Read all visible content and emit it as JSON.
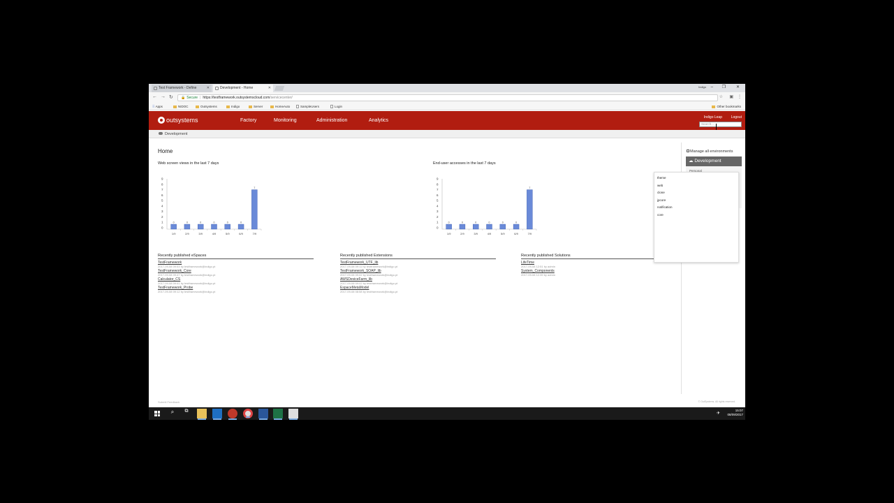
{
  "browser": {
    "tabs": [
      {
        "label": "Test Framework - Define"
      },
      {
        "label": "Development - Home"
      }
    ],
    "window_label": "Indigo",
    "address": {
      "secure_label": "Secure",
      "url_host": "https://testframework.outsystemscloud.com",
      "url_path": "/servicecenter/"
    },
    "bookmarks": [
      "Apps",
      "NIDOC",
      "Outsystems",
      "Indigo",
      "Server",
      "HomeAuto",
      "SampleUsers",
      "Login"
    ],
    "other_bookmarks": "Other bookmarks"
  },
  "header": {
    "logo_text": "outsystems",
    "nav": [
      "Factory",
      "Monitoring",
      "Administration",
      "Analytics"
    ],
    "user": "Indigo Leap",
    "logout": "Logout",
    "search_placeholder": "Search..."
  },
  "subheader": {
    "environment": "Development"
  },
  "page_title": "Home",
  "charts": {
    "screen_views_title": "Web screen views in the last 7 days",
    "accesses_title": "End-user accesses in the last 7 days"
  },
  "chart_data": [
    {
      "type": "bar",
      "title": "Web screen views in the last 7 days",
      "categories": [
        "1/9",
        "2/9",
        "3/9",
        "4/9",
        "5/9",
        "6/9",
        "7/9"
      ],
      "values": [
        0,
        0,
        0,
        0,
        0,
        0,
        7
      ],
      "yticks": [
        0,
        1,
        2,
        3,
        4,
        5,
        6,
        7,
        8,
        9
      ],
      "ylim": [
        0,
        9
      ],
      "color": "#6a8ad8"
    },
    {
      "type": "bar",
      "title": "End-user accesses in the last 7 days",
      "categories": [
        "1/9",
        "2/9",
        "3/9",
        "4/9",
        "5/9",
        "6/9",
        "7/9"
      ],
      "values": [
        0,
        0,
        0,
        0,
        0,
        0,
        7
      ],
      "yticks": [
        0,
        1,
        2,
        3,
        4,
        5,
        6,
        7,
        8,
        9
      ],
      "ylim": [
        0,
        9
      ],
      "color": "#6a8ad8"
    }
  ],
  "sections": {
    "espaces": {
      "title": "Recently published eSpaces",
      "items": [
        {
          "name": "TestFramework",
          "meta": "2017-09-08 09:53 by testframework@indigo.pt"
        },
        {
          "name": "TestFramework_Core",
          "meta": "2017-09-08 09:47 by testframework@indigo.pt"
        },
        {
          "name": "Calculator_CS",
          "meta": "2017-09-08 09:41 by testframework@indigo.pt"
        },
        {
          "name": "TestFramework_Probe",
          "meta": "2017-09-08 09:12 by testframework@indigo.pt"
        }
      ]
    },
    "extensions": {
      "title": "Recently published Extensions",
      "items": [
        {
          "name": "TestFramework_UTF_lib",
          "meta": "2017-09-08 09:11 by testframework@indigo.pt"
        },
        {
          "name": "TestFramework_SOAP_lib",
          "meta": "2017-09-08 09:02 by testframework@indigo.pt"
        },
        {
          "name": "AWSDeviceFarm_lib",
          "meta": "2017-09-08 09:02 by testframework@indigo.pt"
        },
        {
          "name": "EspaceMetaModel",
          "meta": "2017-09-08 08:58 by testframework@indigo.pt"
        }
      ]
    },
    "solutions": {
      "title": "Recently published Solutions",
      "items": [
        {
          "name": "LifeTime",
          "meta": "2017-09-08 12:51 by admin"
        },
        {
          "name": "System_Components",
          "meta": "2017-09-08 12:39 by admin"
        }
      ]
    }
  },
  "right_panel": {
    "manage_link": "Manage all environments",
    "environment": "Development",
    "under_item": "Personal"
  },
  "autocomplete": [
    "theme",
    "web",
    "clone",
    "jpcore",
    "notification",
    "core"
  ],
  "footer": {
    "left": "Submit Feedback",
    "right": "© OutSystems. All rights reserved."
  },
  "taskbar": {
    "time": "15:07",
    "date": "08/09/2017"
  }
}
